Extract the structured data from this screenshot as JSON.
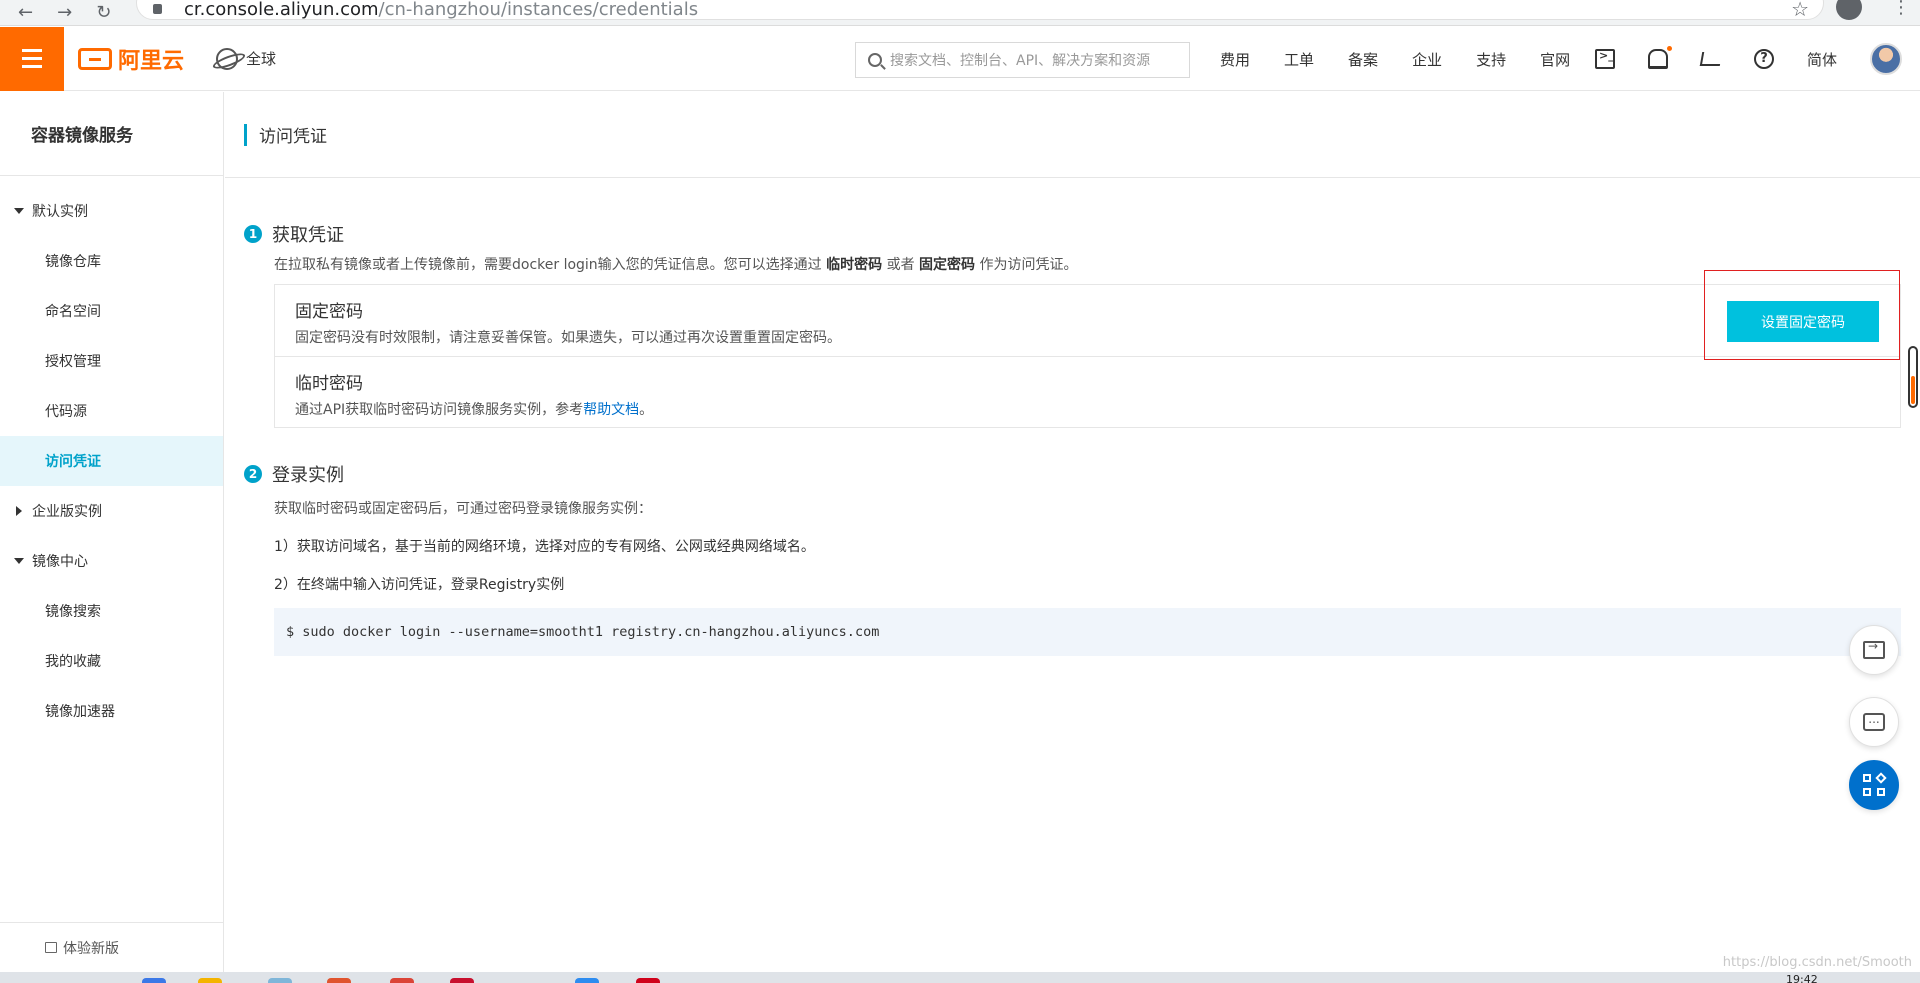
{
  "browser": {
    "url_host": "cr.console.aliyun.com",
    "url_path": "/cn-hangzhou/instances/credentials"
  },
  "topbar": {
    "brand": "阿里云",
    "region": "全球",
    "search_placeholder": "搜索文档、控制台、API、解决方案和资源",
    "links": [
      "费用",
      "工单",
      "备案",
      "企业",
      "支持",
      "官网"
    ],
    "language": "简体"
  },
  "sidebar": {
    "title": "容器镜像服务",
    "groups": [
      {
        "label": "默认实例",
        "expanded": true,
        "items": [
          "镜像仓库",
          "命名空间",
          "授权管理",
          "代码源",
          "访问凭证"
        ]
      },
      {
        "label": "企业版实例",
        "expanded": false,
        "items": []
      },
      {
        "label": "镜像中心",
        "expanded": true,
        "items": [
          "镜像搜索",
          "我的收藏",
          "镜像加速器"
        ]
      }
    ],
    "active_item": "访问凭证",
    "bottom": "体验新版"
  },
  "page": {
    "title": "访问凭证",
    "step1": {
      "num": "1",
      "title": "获取凭证",
      "desc_prefix": "在拉取私有镜像或者上传镜像前，需要docker login输入您的凭证信息。您可以选择通过",
      "desc_temp": "临时密码",
      "desc_or": "或者",
      "desc_fixed": "固定密码",
      "desc_suffix": "作为访问凭证。",
      "fixed_title": "固定密码",
      "fixed_desc": "固定密码没有时效限制，请注意妥善保管。如果遗失，可以通过再次设置重置固定密码。",
      "temp_title": "临时密码",
      "temp_desc_prefix": "通过API获取临时密码访问镜像服务实例，参考",
      "temp_desc_link": "帮助文档",
      "temp_desc_suffix": "。",
      "set_button": "设置固定密码"
    },
    "step2": {
      "num": "2",
      "title": "登录实例",
      "desc": "获取临时密码或固定密码后，可通过密码登录镜像服务实例：",
      "line1": "1）获取访问域名，基于当前的网络环境，选择对应的专有网络、公网或经典网络域名。",
      "line2": "2）在终端中输入访问凭证，登录Registry实例",
      "command": "$ sudo docker login --username=smootht1 registry.cn-hangzhou.aliyuncs.com"
    }
  },
  "watermark": "https://blog.csdn.net/Smooth",
  "clock": "19:42",
  "colors": {
    "brand": "#ff6a00",
    "accent": "#00a2ca",
    "button": "#00c1de",
    "link": "#0070cc",
    "highlight": "#e02020"
  }
}
